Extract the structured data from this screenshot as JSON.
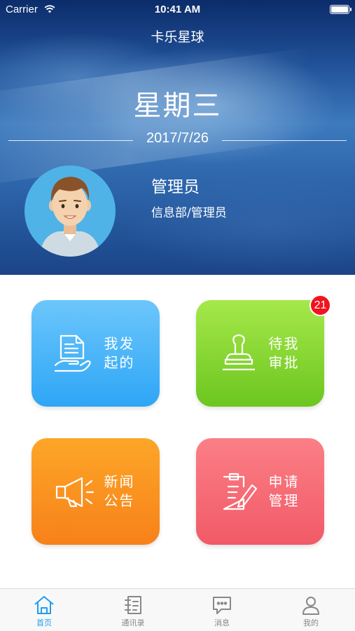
{
  "status_bar": {
    "carrier": "Carrier",
    "time": "10:41 AM"
  },
  "nav": {
    "title": "卡乐星球"
  },
  "header": {
    "weekday": "星期三",
    "date": "2017/7/26"
  },
  "user": {
    "name": "管理员",
    "department": "信息部/管理员",
    "avatar_color": "#4fb3e8"
  },
  "tiles": [
    {
      "label_line1": "我发",
      "label_line2": "起的",
      "icon": "document-hand-icon",
      "color": "#2ea6f6"
    },
    {
      "label_line1": "待我",
      "label_line2": "审批",
      "icon": "stamp-icon",
      "color": "#6cc61f",
      "badge": "21"
    },
    {
      "label_line1": "新闻",
      "label_line2": "公告",
      "icon": "megaphone-icon",
      "color": "#f7811a"
    },
    {
      "label_line1": "申请",
      "label_line2": "管理",
      "icon": "edit-document-icon",
      "color": "#f15a67"
    }
  ],
  "tabbar": {
    "items": [
      {
        "label": "首页",
        "icon": "home-icon",
        "active": true
      },
      {
        "label": "通讯录",
        "icon": "contacts-icon",
        "active": false
      },
      {
        "label": "消息",
        "icon": "message-icon",
        "active": false
      },
      {
        "label": "我的",
        "icon": "person-icon",
        "active": false
      }
    ],
    "active_color": "#1e9ef0"
  }
}
